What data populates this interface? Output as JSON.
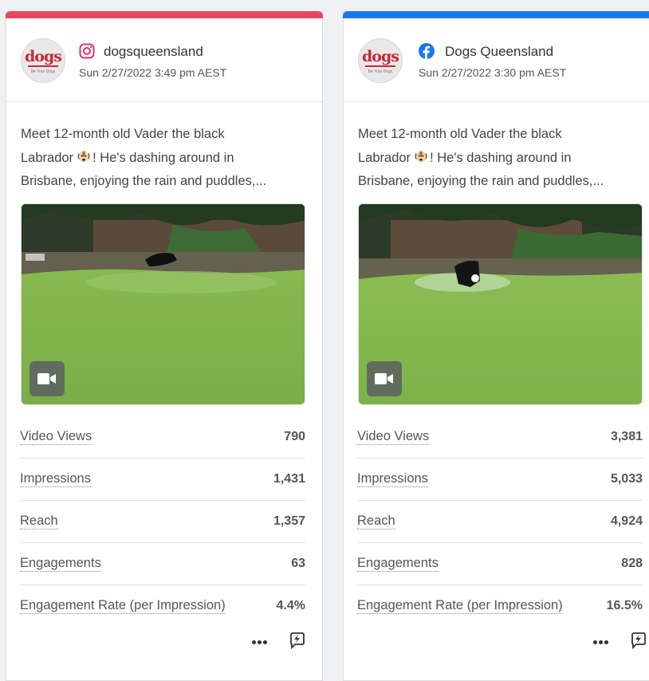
{
  "colors": {
    "instagram_bar": "#e8485f",
    "facebook_bar": "#1877f2",
    "facebook_blue": "#1877f2",
    "instagram_pink": "#e1306c",
    "brand_red": "#c8283c"
  },
  "cards": [
    {
      "network": "instagram",
      "network_icon": "instagram-icon",
      "account": "dogsqueensland",
      "timestamp": "Sun 2/27/2022 3:49 pm AEST",
      "caption_lines": [
        "Meet 12-month old Vader the black",
        "Labrador",
        "! He's dashing around in",
        "Brisbane, enjoying the rain and puddles,..."
      ],
      "emoji": "dog-face-emoji",
      "media_type": "video-icon",
      "metrics": [
        {
          "label": "Video Views",
          "value": "790"
        },
        {
          "label": "Impressions",
          "value": "1,431"
        },
        {
          "label": "Reach",
          "value": "1,357"
        },
        {
          "label": "Engagements",
          "value": "63"
        },
        {
          "label": "Engagement Rate (per Impression)",
          "value": "4.4%"
        }
      ],
      "actions": [
        "more-icon",
        "boost-icon"
      ]
    },
    {
      "network": "facebook",
      "network_icon": "facebook-icon",
      "account": "Dogs Queensland",
      "timestamp": "Sun 2/27/2022 3:30 pm AEST",
      "caption_lines": [
        "Meet 12-month old Vader the black",
        "Labrador",
        "! He's dashing around in",
        "Brisbane, enjoying the rain and puddles,..."
      ],
      "emoji": "dog-face-emoji",
      "media_type": "video-icon",
      "metrics": [
        {
          "label": "Video Views",
          "value": "3,381"
        },
        {
          "label": "Impressions",
          "value": "5,033"
        },
        {
          "label": "Reach",
          "value": "4,924"
        },
        {
          "label": "Engagements",
          "value": "828"
        },
        {
          "label": "Engagement Rate (per Impression)",
          "value": "16.5%"
        }
      ],
      "actions": [
        "more-icon",
        "boost-icon"
      ]
    }
  ],
  "avatar": {
    "logo_text": "dogs",
    "tagline": "Be Your Dogs"
  }
}
